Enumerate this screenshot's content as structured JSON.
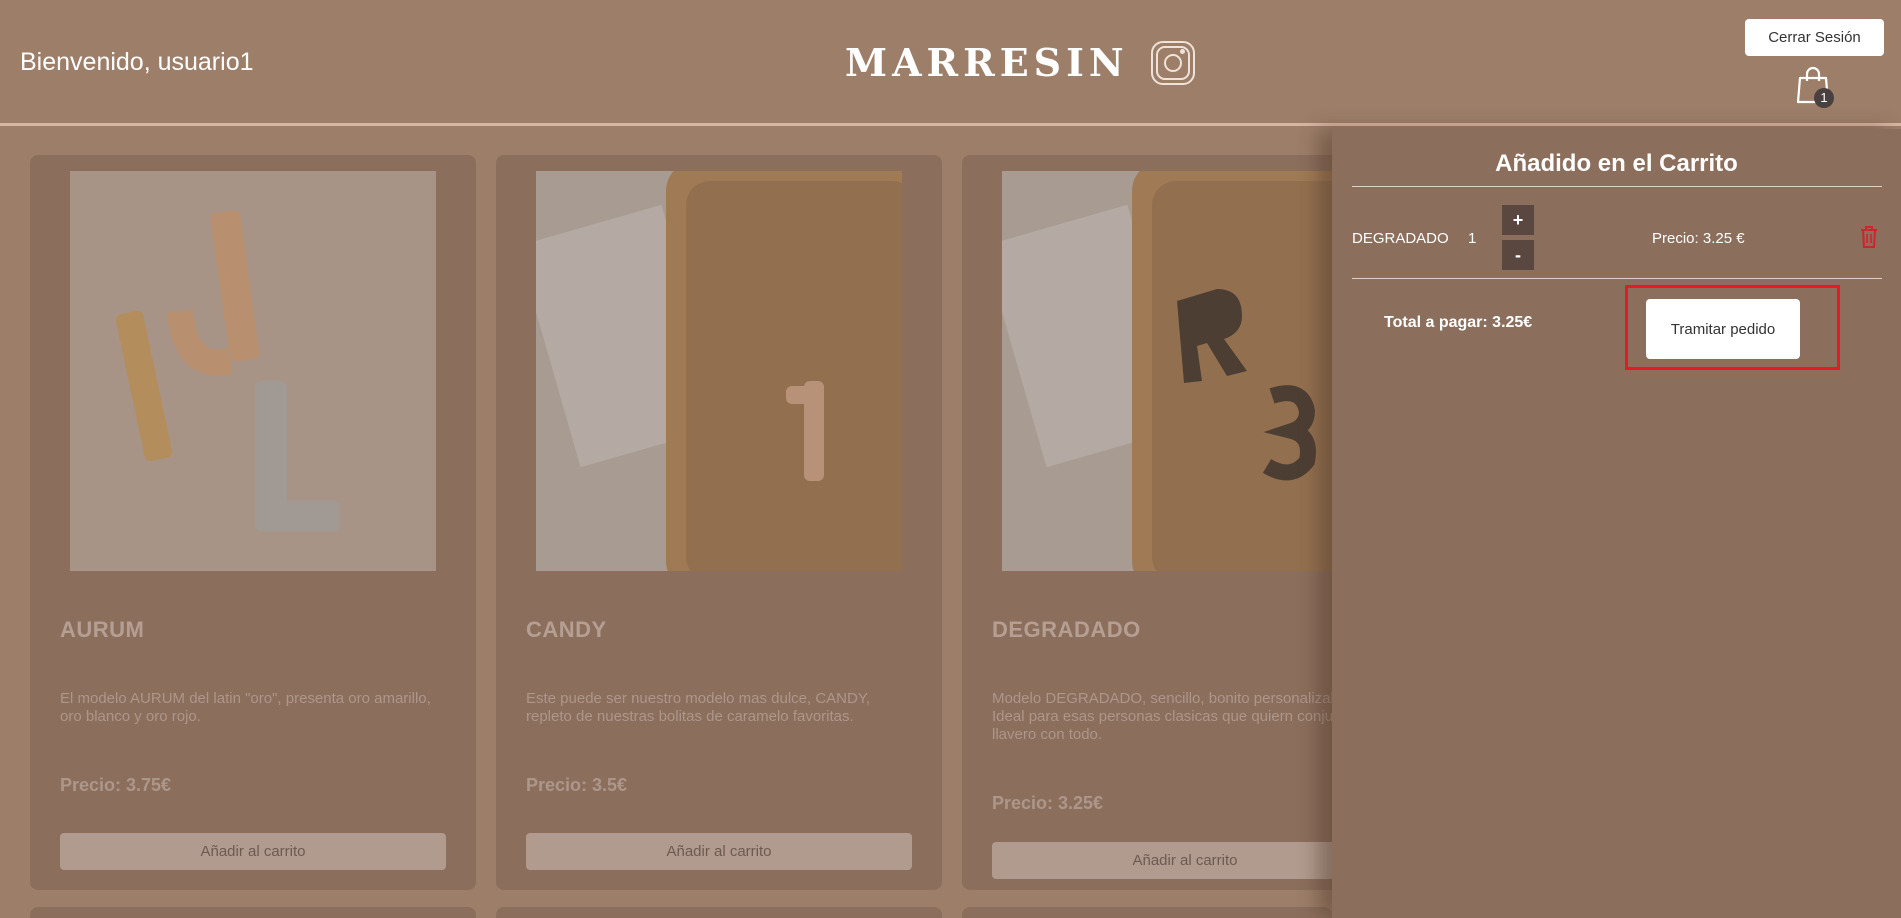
{
  "header": {
    "welcome": "Bienvenido, usuario1",
    "brand": "MARRESIN",
    "logout_label": "Cerrar Sesión",
    "cart_count": "1"
  },
  "products": [
    {
      "title": "AURUM",
      "description": "El modelo AURUM del latin \"oro\", presenta oro amarillo, oro blanco y oro rojo.",
      "price": "Precio: 3.75€",
      "add_label": "Añadir al carrito"
    },
    {
      "title": "CANDY",
      "description": "Este puede ser nuestro modelo mas dulce, CANDY, repleto de nuestras bolitas de caramelo favoritas.",
      "price": "Precio: 3.5€",
      "add_label": "Añadir al carrito"
    },
    {
      "title": "DEGRADADO",
      "description": "Modelo DEGRADADO, sencillo, bonito personalizable. Ideal para esas personas clasicas que quiern conjuntar su llavero con todo.",
      "price": "Precio: 3.25€",
      "add_label": "Añadir al carrito"
    }
  ],
  "cart_panel": {
    "title": "Añadido en el Carrito",
    "items": [
      {
        "name": "DEGRADADO",
        "quantity": "1",
        "plus_label": "+",
        "minus_label": "-",
        "price": "Precio: 3.25 €"
      }
    ],
    "total": "Total a pagar: 3.25€",
    "checkout_label": "Tramitar pedido"
  },
  "colors": {
    "background": "#9c7e69",
    "panel": "#8b6e5c",
    "highlight": "#e31b23",
    "trash": "#d0232a"
  }
}
